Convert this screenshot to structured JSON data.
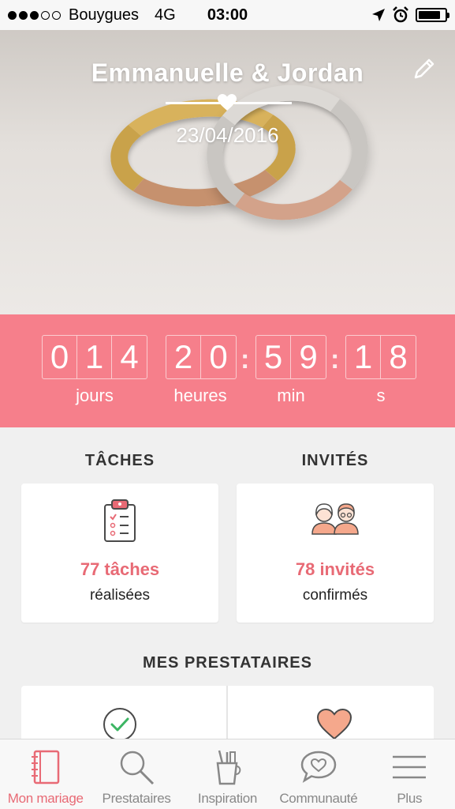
{
  "status_bar": {
    "carrier": "Bouygues",
    "network": "4G",
    "time": "03:00"
  },
  "hero": {
    "title": "Emmanuelle & Jordan",
    "date": "23/04/2016"
  },
  "countdown": {
    "days_digits": [
      "0",
      "1",
      "4"
    ],
    "hours_digits": [
      "2",
      "0"
    ],
    "minutes_digits": [
      "5",
      "9"
    ],
    "seconds_digits": [
      "1",
      "8"
    ],
    "days_label": "jours",
    "hours_label": "heures",
    "minutes_label": "min",
    "seconds_label": "s"
  },
  "tasks": {
    "section_title": "TÂCHES",
    "count": "77 tâches",
    "sub": "réalisées"
  },
  "guests": {
    "section_title": "INVITÉS",
    "count": "78 invités",
    "sub": "confirmés"
  },
  "vendors": {
    "section_title": "MES PRESTATAIRES"
  },
  "tabs": [
    {
      "label": "Mon mariage",
      "icon": "notebook-icon",
      "active": true
    },
    {
      "label": "Prestataires",
      "icon": "search-icon",
      "active": false
    },
    {
      "label": "Inspiration",
      "icon": "pencil-cup-icon",
      "active": false
    },
    {
      "label": "Communauté",
      "icon": "chat-heart-icon",
      "active": false
    },
    {
      "label": "Plus",
      "icon": "menu-icon",
      "active": false
    }
  ],
  "colors": {
    "accent": "#f67f8b",
    "accent_text": "#e86a75",
    "check_green": "#3cb563",
    "heart_peach": "#f5a88c"
  }
}
